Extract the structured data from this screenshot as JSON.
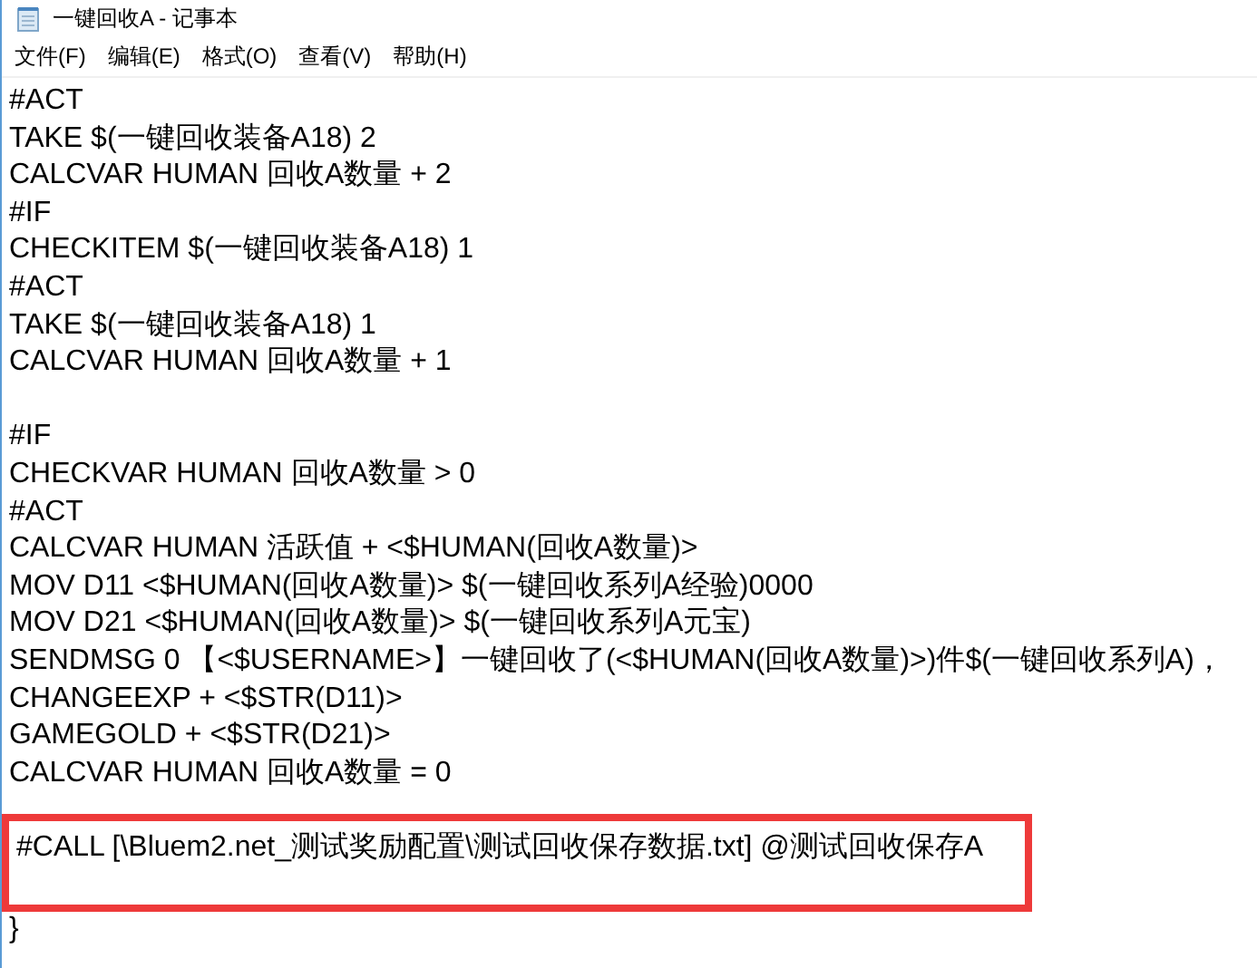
{
  "window": {
    "title": "一键回收A - 记事本"
  },
  "menu": [
    "文件(F)",
    "编辑(E)",
    "格式(O)",
    "查看(V)",
    "帮助(H)"
  ],
  "editor": {
    "blocks": [
      {
        "kind": "plain",
        "lines": [
          {
            "kind": "code",
            "text": "#ACT"
          },
          {
            "kind": "code",
            "text": "TAKE $(一键回收装备A18) 2"
          },
          {
            "kind": "code",
            "text": "CALCVAR HUMAN 回收A数量 + 2"
          },
          {
            "kind": "code",
            "text": "#IF"
          },
          {
            "kind": "code",
            "text": "CHECKITEM $(一键回收装备A18) 1"
          },
          {
            "kind": "code",
            "text": "#ACT"
          },
          {
            "kind": "code",
            "text": "TAKE $(一键回收装备A18) 1"
          },
          {
            "kind": "code",
            "text": "CALCVAR HUMAN 回收A数量 + 1"
          },
          {
            "kind": "blank"
          },
          {
            "kind": "code",
            "text": "#IF"
          },
          {
            "kind": "code",
            "text": "CHECKVAR HUMAN 回收A数量 > 0"
          },
          {
            "kind": "code",
            "text": "#ACT"
          },
          {
            "kind": "code",
            "text": "CALCVAR HUMAN 活跃值 + <$HUMAN(回收A数量)>"
          },
          {
            "kind": "code",
            "text": "MOV D11 <$HUMAN(回收A数量)> $(一键回收系列A经验)0000"
          },
          {
            "kind": "code",
            "text": "MOV D21 <$HUMAN(回收A数量)> $(一键回收系列A元宝)"
          },
          {
            "kind": "code",
            "text": "SENDMSG 0 【<$USERNAME>】一键回收了(<$HUMAN(回收A数量)>)件$(一键回收系列A)，"
          },
          {
            "kind": "code",
            "text": "CHANGEEXP + <$STR(D11)>"
          },
          {
            "kind": "code",
            "text": "GAMEGOLD + <$STR(D21)>"
          },
          {
            "kind": "code",
            "text": "CALCVAR HUMAN 回收A数量 = 0"
          },
          {
            "kind": "blank"
          }
        ]
      },
      {
        "kind": "boxed",
        "lines": [
          {
            "kind": "code",
            "text": "#CALL [\\Bluem2.net_测试奖励配置\\测试回收保存数据.txt] @测试回收保存A"
          },
          {
            "kind": "blank"
          }
        ]
      },
      {
        "kind": "plain",
        "lines": [
          {
            "kind": "code",
            "text": "}"
          }
        ]
      }
    ]
  }
}
